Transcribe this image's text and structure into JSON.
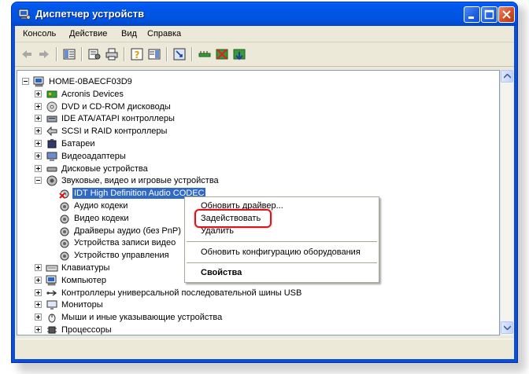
{
  "window": {
    "title": "Диспетчер устройств"
  },
  "menubar": {
    "items": [
      "Консоль",
      "Действие",
      "Вид",
      "Справка"
    ]
  },
  "toolbar": {
    "buttons": [
      "back-icon",
      "forward-icon",
      "tree-view-icon",
      "properties-icon",
      "print-icon",
      "help-icon",
      "pane-icon",
      "scan-hardware-icon",
      "update-driver-icon",
      "uninstall-icon",
      "enable-icon"
    ]
  },
  "tree": {
    "root": "HOME-0BAECF03D9",
    "categories": [
      {
        "label": "Acronis Devices",
        "icon": "device-icon"
      },
      {
        "label": "DVD и CD-ROM дисководы",
        "icon": "cdrom-icon"
      },
      {
        "label": "IDE ATA/ATAPI контроллеры",
        "icon": "ide-icon"
      },
      {
        "label": "SCSI и RAID контроллеры",
        "icon": "scsi-icon"
      },
      {
        "label": "Батареи",
        "icon": "battery-icon"
      },
      {
        "label": "Видеоадаптеры",
        "icon": "display-icon"
      },
      {
        "label": "Дисковые устройства",
        "icon": "disk-icon"
      },
      {
        "label": "Звуковые, видео и игровые устройства",
        "icon": "sound-icon"
      }
    ],
    "sound_children": [
      {
        "label": "IDT High Definition Audio CODEC",
        "selected": true,
        "disabled": true
      },
      {
        "label": "Аудио кодеки"
      },
      {
        "label": "Видео кодеки"
      },
      {
        "label": "Драйверы аудио (без PnP)"
      },
      {
        "label": "Устройства записи видео"
      },
      {
        "label": "Устройство управления"
      }
    ],
    "more_categories": [
      {
        "label": "Клавиатуры",
        "icon": "keyboard-icon"
      },
      {
        "label": "Компьютер",
        "icon": "computer-icon"
      },
      {
        "label": "Контроллеры универсальной последовательной шины USB",
        "icon": "usb-icon"
      },
      {
        "label": "Мониторы",
        "icon": "monitor-icon"
      },
      {
        "label": "Мыши и иные указывающие устройства",
        "icon": "mouse-icon"
      },
      {
        "label": "Процессоры",
        "icon": "cpu-icon"
      }
    ]
  },
  "context_menu": {
    "update_driver": "Обновить драйвер...",
    "enable": "Задействовать",
    "remove": "Удалить",
    "scan": "Обновить конфигурацию оборудования",
    "properties": "Свойства"
  },
  "colors": {
    "titlebar": "#0054e3",
    "selection": "#316ac5",
    "highlight_ring": "#d9141d"
  }
}
